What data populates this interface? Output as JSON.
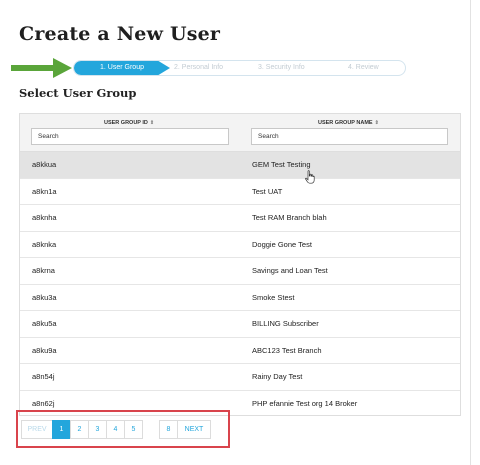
{
  "header": {
    "title": "Create a New User"
  },
  "stepper": {
    "steps": [
      {
        "label": "1. User Group",
        "state": "active"
      },
      {
        "label": "2. Personal Info",
        "state": "inactive"
      },
      {
        "label": "3. Security Info",
        "state": "inactive"
      },
      {
        "label": "4. Review",
        "state": "inactive"
      }
    ]
  },
  "section": {
    "title": "Select User Group"
  },
  "table": {
    "columns": [
      {
        "label": "USER GROUP ID",
        "sort_icon": "⇕",
        "search_placeholder": "Search"
      },
      {
        "label": "USER GROUP NAME",
        "sort_icon": "⇕",
        "search_placeholder": "Search"
      }
    ],
    "rows": [
      {
        "id": "a8kkua",
        "name": "GEM Test Testing",
        "selected": true
      },
      {
        "id": "a8kn1a",
        "name": "Test UAT"
      },
      {
        "id": "a8knha",
        "name": "Test RAM Branch blah"
      },
      {
        "id": "a8knka",
        "name": "Doggie Gone Test"
      },
      {
        "id": "a8krna",
        "name": "Savings and Loan Test"
      },
      {
        "id": "a8ku3a",
        "name": "Smoke Stest"
      },
      {
        "id": "a8ku5a",
        "name": "BILLING Subscriber"
      },
      {
        "id": "a8ku9a",
        "name": "ABC123 Test Branch"
      },
      {
        "id": "a8n54j",
        "name": "Rainy Day Test"
      },
      {
        "id": "a8n62j",
        "name": "PHP efannie Test org 14 Broker"
      }
    ]
  },
  "pagination": {
    "prev": "PREV",
    "pages": [
      "1",
      "2",
      "3",
      "4",
      "5"
    ],
    "last": "8",
    "next": "NEXT",
    "current": "1"
  },
  "colors": {
    "accent": "#23a6dc",
    "annotation_red": "#d9444c",
    "annotation_arrow": "#5aa53a"
  }
}
